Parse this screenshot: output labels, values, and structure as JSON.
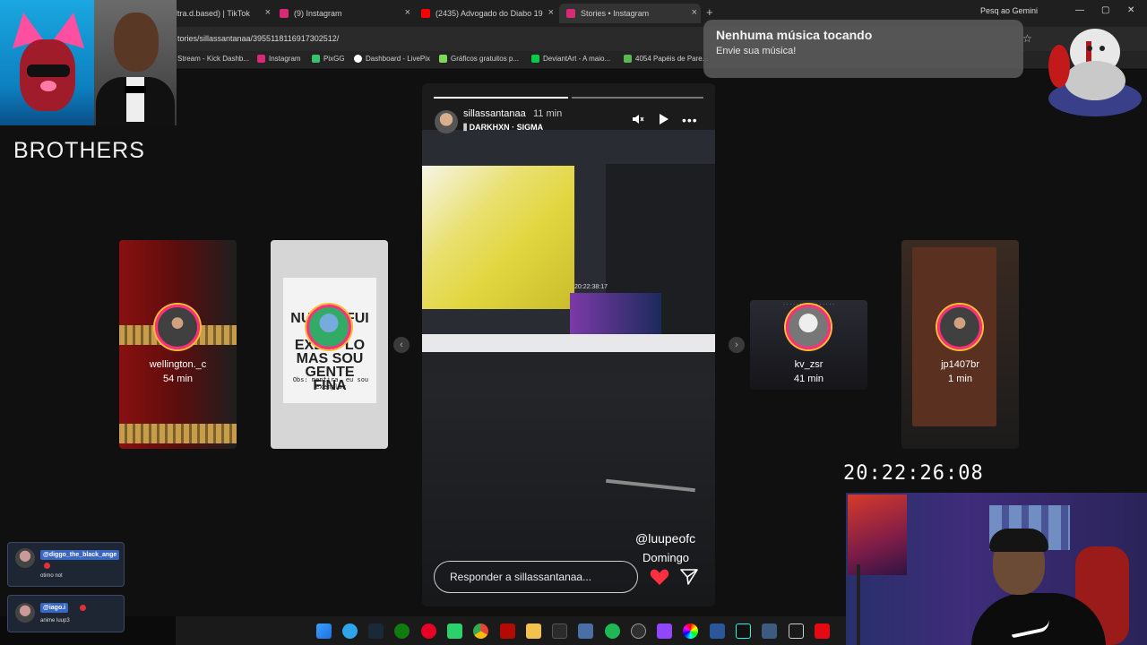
{
  "browser": {
    "tabs": [
      {
        "title": "ltra.d.based) | TikTok",
        "color": "#111111"
      },
      {
        "title": "(9) Instagram",
        "color": "#d62976"
      },
      {
        "title": "(2435) Advogado do Diabo 19",
        "color": "#ff0000"
      },
      {
        "title": "Stories • Instagram",
        "color": "#d62976",
        "active": true
      }
    ],
    "gemini_label": "Pesq ao Gemini",
    "url": "tories/sillassantanaa/3955118116917302512/",
    "bookmarks": [
      {
        "label": "Stream - Kick Dashb...",
        "color": "#53fc18"
      },
      {
        "label": "Instagram",
        "color": "#d62976"
      },
      {
        "label": "PixGG",
        "color": "#36c36c"
      },
      {
        "label": "Dashboard - LivePix",
        "color": "#ffffff"
      },
      {
        "label": "Gráficos gratuitos p...",
        "color": "#7ed957"
      },
      {
        "label": "DeviantArt - A maio...",
        "color": "#05cc47"
      },
      {
        "label": "4054 Papéis de Pare...",
        "color": "#59b84f"
      }
    ]
  },
  "overlay": {
    "brothers_label": "BROTHERS",
    "music": {
      "title": "Nenhuma música tocando",
      "subtitle": "Envie sua música!"
    },
    "timer": "20:22:26:08"
  },
  "stories": {
    "left": [
      {
        "username": "wellington._c",
        "time": "54 min"
      },
      {
        "username": "",
        "time": "",
        "meme_text": "NUNCA FUI BOM EXEMPLO MAS SOU GENTE FINA",
        "obs_text": "Obs: mentira, eu sou exemplar"
      }
    ],
    "right": [
      {
        "username": "kv_zsr",
        "time": "41 min"
      },
      {
        "username": "jp1407br",
        "time": "1 min"
      }
    ],
    "main": {
      "username": "sillassantanaa",
      "time": "11 min",
      "song": "DARKHXN · SIGMA",
      "inner_clock": "20:22:38:17",
      "mention": "@luupeofc",
      "day": "Domingo",
      "reply_placeholder": "Responder a sillassantanaa...",
      "progress_segments": [
        1.0,
        0.0
      ]
    }
  },
  "chat": [
    {
      "user": "@diggo_the_black_ange",
      "message": "otimo not"
    },
    {
      "user": "@iago.i",
      "message": "anime luup3"
    }
  ],
  "taskbar_icons": [
    "windows-icon",
    "edge-icon",
    "steam-icon",
    "xbox-icon",
    "pinterest-icon",
    "b-icon",
    "chrome-icon",
    "acrobat-icon",
    "folder-icon",
    "terminal-icon",
    "calculator-icon",
    "spotify-icon",
    "obs-icon",
    "app-icon",
    "colors-icon",
    "word-icon",
    "tiktok-icon",
    "app2-icon",
    "capcut-icon",
    "netflix-icon",
    "chrome2-icon"
  ],
  "colors": {
    "instagram_gradient_start": "#ffbb33",
    "instagram_gradient_end": "#ff2f7a",
    "heart": "#ff3040"
  }
}
